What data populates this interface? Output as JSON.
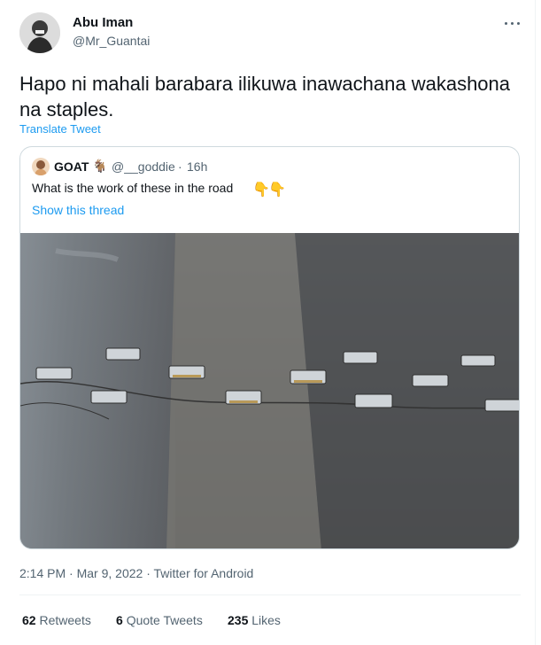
{
  "author": {
    "name": "Abu Iman",
    "handle": "@Mr_Guantai"
  },
  "tweet": {
    "text": "Hapo ni mahali barabara ilikuwa inawachana wakashona na staples.",
    "translate_label": "Translate Tweet"
  },
  "quoted": {
    "name": "GOAT",
    "name_emoji": "🐐",
    "handle": "@__goddie",
    "separator": "·",
    "time": "16h",
    "text": "What is the work of these in the road",
    "text_emojis": [
      "👇",
      "👇"
    ],
    "show_thread": "Show this thread",
    "image_alt_icon": "road-studs-photo"
  },
  "meta": {
    "time": "2:14 PM",
    "separator": "·",
    "date": "Mar 9, 2022",
    "source": "Twitter for Android"
  },
  "stats": {
    "retweets_count": "62",
    "retweets_label": "Retweets",
    "quote_count": "6",
    "quote_label": "Quote Tweets",
    "likes_count": "235",
    "likes_label": "Likes"
  },
  "colors": {
    "link": "#1d9bf0",
    "secondary_text": "#536471",
    "border": "#cfd9de"
  }
}
